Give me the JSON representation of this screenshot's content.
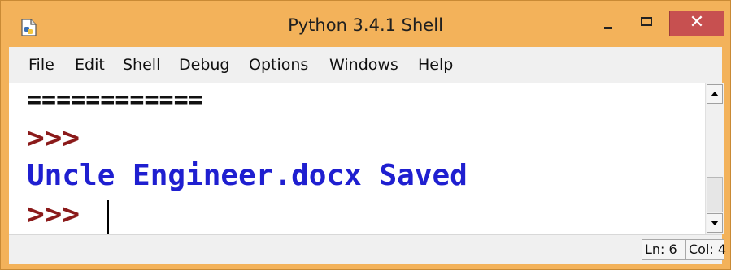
{
  "window": {
    "title": "Python 3.4.1 Shell",
    "close_glyph": "✕",
    "controls": [
      "minimize-icon",
      "maximize-icon",
      "close-icon"
    ]
  },
  "menu": [
    {
      "label": "File",
      "underline": "F",
      "rest": "ile"
    },
    {
      "label": "Edit",
      "underline": "E",
      "rest": "dit"
    },
    {
      "label": "Shell",
      "pre": "She",
      "underline": "l",
      "rest": "l"
    },
    {
      "label": "Debug",
      "underline": "D",
      "rest": "ebug"
    },
    {
      "label": "Options",
      "underline": "O",
      "rest": "ptions"
    },
    {
      "label": "Windows",
      "underline": "W",
      "rest": "indows"
    },
    {
      "label": "Help",
      "underline": "H",
      "rest": "elp"
    }
  ],
  "editor": {
    "separator": "============",
    "prompt1": ">>>",
    "output": "Uncle Engineer.docx Saved",
    "prompt2": ">>> "
  },
  "status": {
    "line": "Ln: 6",
    "col": "Col: 4"
  },
  "colors": {
    "titlebar": "#f3b25a",
    "close_button": "#c75050",
    "prompt": "#8b1a1a",
    "output": "#1f1fd0"
  }
}
